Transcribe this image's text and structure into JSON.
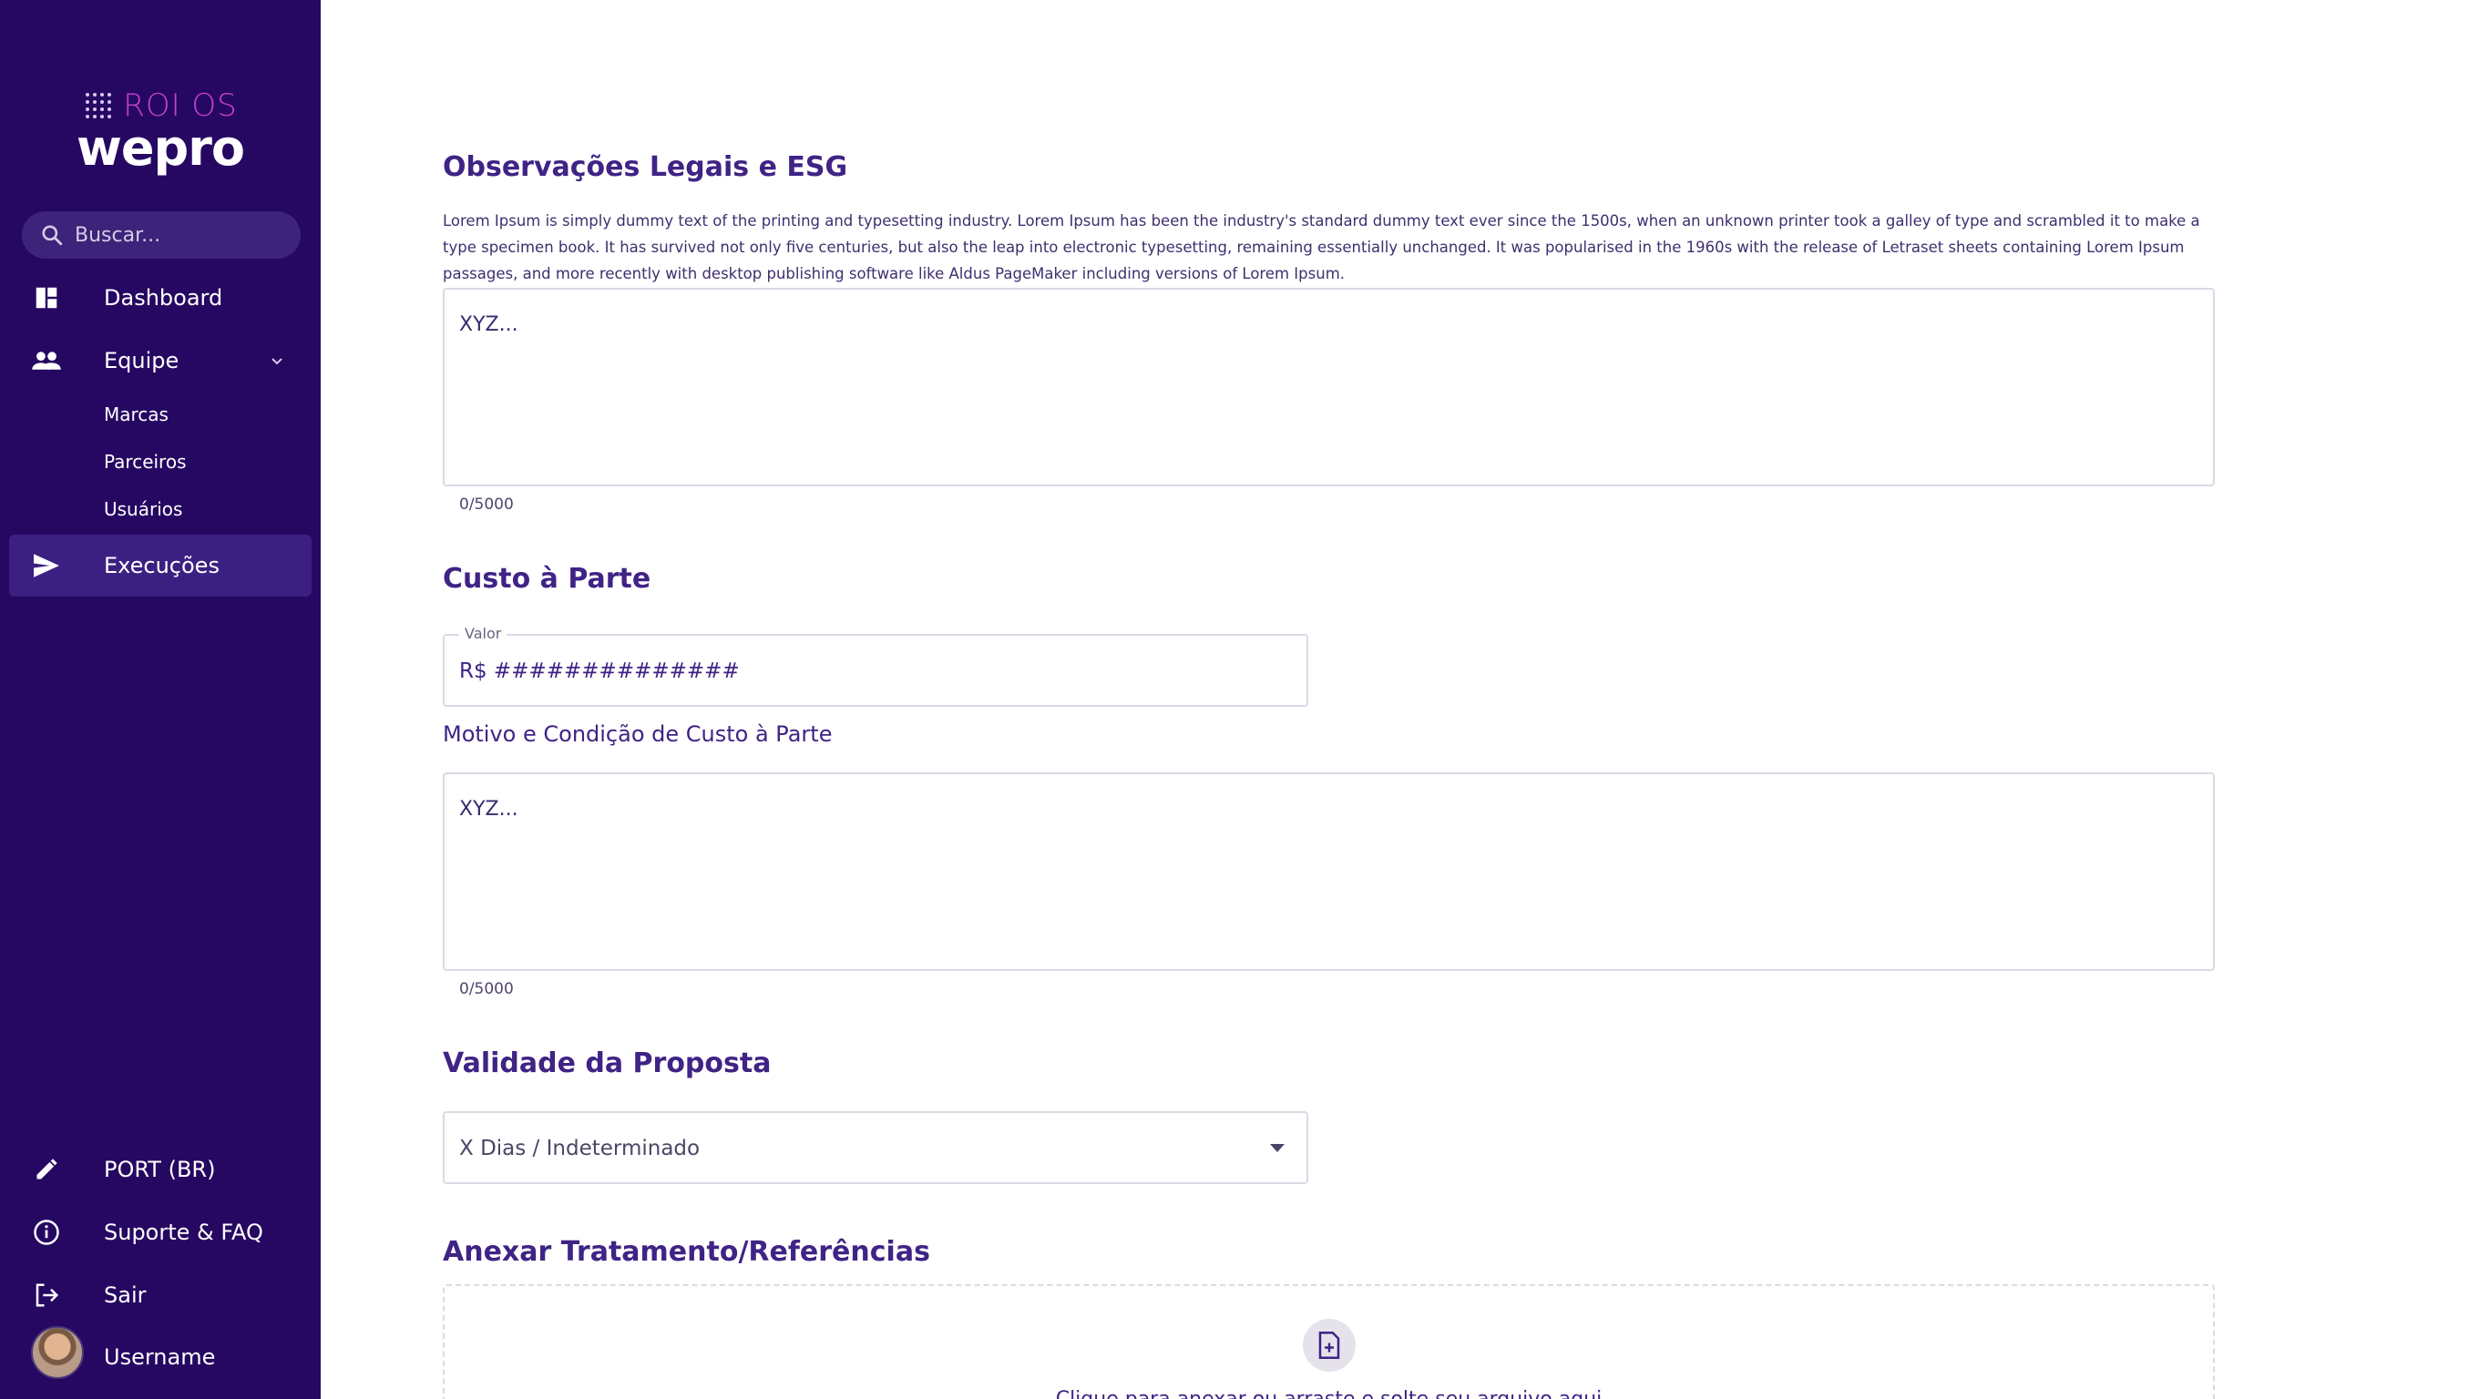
{
  "sidebar": {
    "brand_top": "ROI OS",
    "brand_main": "wepro",
    "search_placeholder": "Buscar...",
    "items": [
      {
        "label": "Dashboard",
        "icon": "dashboard-icon"
      },
      {
        "label": "Equipe",
        "icon": "people-icon"
      },
      {
        "label": "Marcas"
      },
      {
        "label": "Parceiros"
      },
      {
        "label": "Usuários"
      },
      {
        "label": "Execuções",
        "icon": "send-icon"
      }
    ],
    "bottom_items": [
      {
        "label": "PORT (BR)",
        "icon": "pencil-icon"
      },
      {
        "label": "Suporte & FAQ",
        "icon": "info-icon"
      },
      {
        "label": "Sair",
        "icon": "logout-icon"
      },
      {
        "label": "Username",
        "icon": "avatar"
      }
    ]
  },
  "main": {
    "legal": {
      "title": "Observações Legais e ESG",
      "description": "Lorem Ipsum is simply dummy text of the printing and typesetting industry. Lorem Ipsum has been the industry's standard dummy text ever since the 1500s, when an unknown printer took a galley of type and scrambled it to make a type specimen book. It has survived not only five centuries, but also the leap into electronic typesetting, remaining essentially unchanged. It was popularised in the 1960s with the release of Letraset sheets containing Lorem Ipsum passages, and more recently with desktop publishing software like Aldus PageMaker including versions of Lorem Ipsum.",
      "value": "XYZ...",
      "counter": "0/5000"
    },
    "cost": {
      "title": "Custo à Parte",
      "value_legend": "Valor",
      "value": "R$ ##############",
      "reason_label": "Motivo e Condição de Custo à Parte",
      "reason_value": "XYZ...",
      "counter": "0/5000"
    },
    "validity": {
      "title": "Validade da Proposta",
      "selected": "X Dias / Indeterminado"
    },
    "attach": {
      "title": "Anexar Tratamento/Referências",
      "prompt": "Clique para anexar ou arraste e solte seu arquivo aqui"
    }
  },
  "colors": {
    "sidebar_bg": "#260862",
    "accent": "#3f2385",
    "brand_pink": "#c93fd1"
  }
}
